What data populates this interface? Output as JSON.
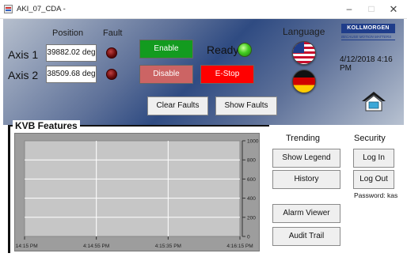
{
  "window": {
    "title": "AKI_07_CDA -",
    "minimize": "–",
    "maximize": "□",
    "close": "✕"
  },
  "header": {
    "position_label": "Position",
    "fault_label": "Fault",
    "language_label": "Language",
    "logo_text": "KOLLMORGEN",
    "logo_sub": "BECAUSE MOTION MATTERS",
    "datetime": "4/12/2018 4:16 PM"
  },
  "axes": [
    {
      "label": "Axis 1",
      "position": "39882.02 deg"
    },
    {
      "label": "Axis 2",
      "position": "38509.68 deg"
    }
  ],
  "controls": {
    "enable": "Enable",
    "disable": "Disable",
    "ready": "Ready",
    "estop": "E-Stop",
    "clear_faults": "Clear Faults",
    "show_faults": "Show Faults"
  },
  "icons": {
    "app": "app-icon",
    "fault_led": "red-led-icon",
    "ready_led": "green-led-icon",
    "flag_us": "us-flag-icon",
    "flag_de": "germany-flag-icon",
    "home": "home-icon"
  },
  "colors": {
    "enable": "#139b1f",
    "disable": "#cc6464",
    "estop": "#ff0000",
    "ready": "#44cc22"
  },
  "kvb": {
    "title": "KVB Features"
  },
  "chart_data": {
    "type": "line",
    "x_ticks": [
      "4:14:15 PM",
      "4:14:55 PM",
      "4:15:35 PM",
      "4:16:15 PM"
    ],
    "y_ticks": [
      "1000",
      "800",
      "600",
      "400",
      "200",
      "0"
    ],
    "ylim": [
      0,
      1000
    ],
    "grid": true,
    "series": []
  },
  "trending": {
    "heading": "Trending",
    "show_legend": "Show Legend",
    "history": "History",
    "alarm_viewer": "Alarm Viewer",
    "audit_trail": "Audit Trail"
  },
  "security": {
    "heading": "Security",
    "log_in": "Log In",
    "log_out": "Log Out",
    "password_hint": "Password: kas"
  }
}
